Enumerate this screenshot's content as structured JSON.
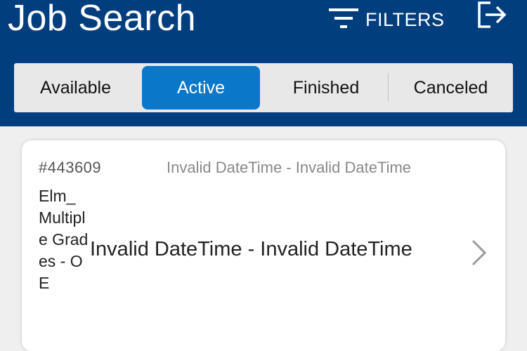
{
  "header": {
    "title": "Job Search",
    "filters_label": "FILTERS"
  },
  "tabs": [
    {
      "label": "Available",
      "active": false
    },
    {
      "label": "Active",
      "active": true
    },
    {
      "label": "Finished",
      "active": false
    },
    {
      "label": "Canceled",
      "active": false
    }
  ],
  "job": {
    "id": "#443609",
    "date_range_small": "Invalid DateTime - Invalid DateTime",
    "name": "Elm_ Multiple Grades - OE",
    "date_range_main": "Invalid DateTime - Invalid DateTime"
  },
  "colors": {
    "header_bg": "#003e7e",
    "active_tab": "#0a77c9"
  },
  "icons": {
    "filters": "filter-icon",
    "logout": "logout-icon",
    "chevron": "chevron-right-icon"
  }
}
